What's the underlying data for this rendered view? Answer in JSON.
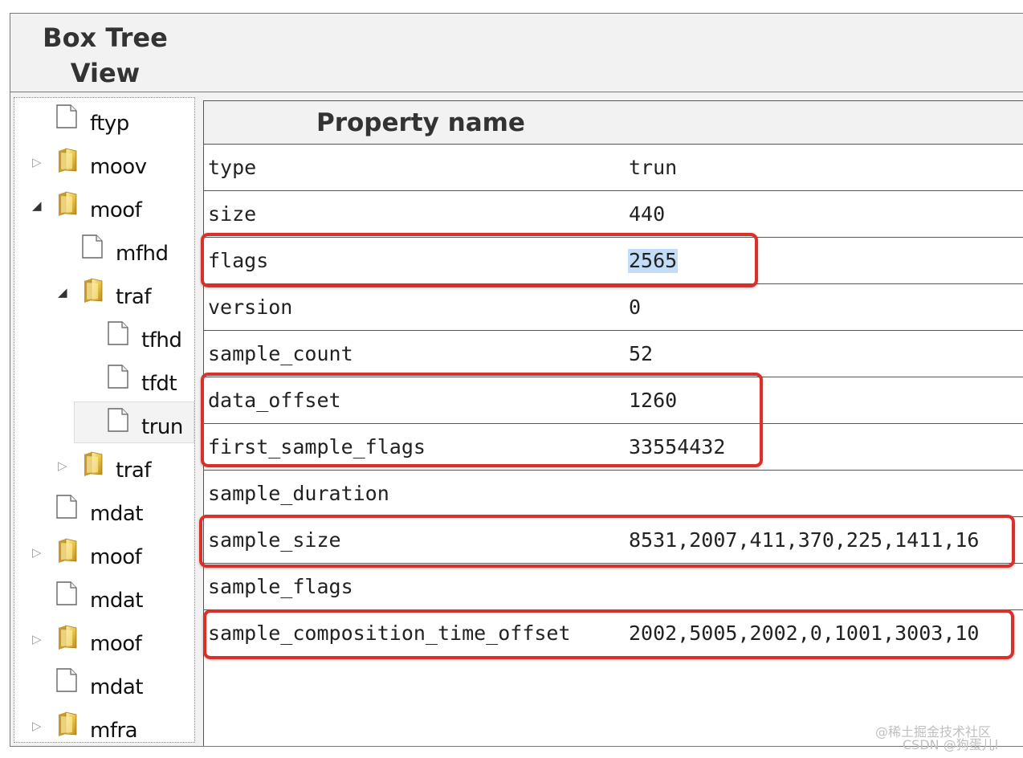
{
  "panel": {
    "title_line1": "Box Tree",
    "title_line2": "View"
  },
  "tree": [
    {
      "label": "ftyp",
      "type": "file",
      "depth": 0,
      "expander": "none"
    },
    {
      "label": "moov",
      "type": "folder",
      "depth": 0,
      "expander": "collapsed"
    },
    {
      "label": "moof",
      "type": "folder",
      "depth": 0,
      "expander": "expanded"
    },
    {
      "label": "mfhd",
      "type": "file",
      "depth": 1,
      "expander": "none"
    },
    {
      "label": "traf",
      "type": "folder",
      "depth": 1,
      "expander": "expanded"
    },
    {
      "label": "tfhd",
      "type": "file",
      "depth": 2,
      "expander": "none"
    },
    {
      "label": "tfdt",
      "type": "file",
      "depth": 2,
      "expander": "none"
    },
    {
      "label": "trun",
      "type": "file",
      "depth": 2,
      "expander": "none",
      "selected": true
    },
    {
      "label": "traf",
      "type": "folder",
      "depth": 1,
      "expander": "collapsed"
    },
    {
      "label": "mdat",
      "type": "file",
      "depth": 0,
      "expander": "none"
    },
    {
      "label": "moof",
      "type": "folder",
      "depth": 0,
      "expander": "collapsed"
    },
    {
      "label": "mdat",
      "type": "file",
      "depth": 0,
      "expander": "none"
    },
    {
      "label": "moof",
      "type": "folder",
      "depth": 0,
      "expander": "collapsed"
    },
    {
      "label": "mdat",
      "type": "file",
      "depth": 0,
      "expander": "none"
    },
    {
      "label": "mfra",
      "type": "folder",
      "depth": 0,
      "expander": "collapsed"
    }
  ],
  "grid": {
    "header": "Property name",
    "rows": [
      {
        "name": "type",
        "value": "trun"
      },
      {
        "name": "size",
        "value": "440"
      },
      {
        "name": "flags",
        "value": "2565",
        "selected": true
      },
      {
        "name": "version",
        "value": "0"
      },
      {
        "name": "sample_count",
        "value": "52"
      },
      {
        "name": "data_offset",
        "value": "1260"
      },
      {
        "name": "first_sample_flags",
        "value": "33554432"
      },
      {
        "name": "sample_duration",
        "value": ""
      },
      {
        "name": "sample_size",
        "value": "8531,2007,411,370,225,1411,16"
      },
      {
        "name": "sample_flags",
        "value": ""
      },
      {
        "name": "sample_composition_time_offset",
        "value": "2002,5005,2002,0,1001,3003,10"
      }
    ]
  },
  "watermark": {
    "line1": "@稀土掘金技术社区",
    "line2": "CSDN @狗蛋儿l"
  },
  "colors": {
    "annotation": "#d9312a",
    "selection": "#c3dcf7",
    "panel_bg": "#f2f2f2"
  }
}
